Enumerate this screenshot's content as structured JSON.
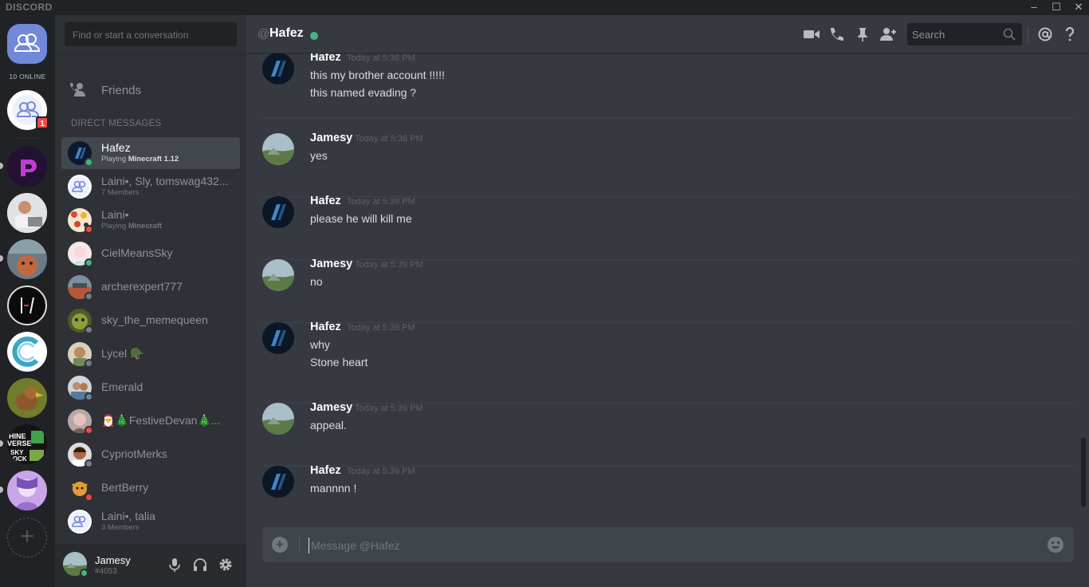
{
  "app": {
    "brand": "DISCORD"
  },
  "window_controls": {
    "minimize": "–",
    "maximize": "☐",
    "close": "✕"
  },
  "guild_bar": {
    "online_label": "10 ONLINE",
    "dm_badge": "1",
    "add_server": "+"
  },
  "dm_sidebar": {
    "search_placeholder": "Find or start a conversation",
    "friends_label": "Friends",
    "direct_messages_heading": "DIRECT MESSAGES",
    "items": [
      {
        "name": "Hafez",
        "sub_prefix": "Playing ",
        "sub_bold": "Minecraft 1.12",
        "status": "online",
        "active": true
      },
      {
        "name": "Laini•, Sly, tomswag432...",
        "sub_prefix": "7 Members",
        "sub_bold": "",
        "status": "",
        "active": false
      },
      {
        "name": "Laini•",
        "sub_prefix": "Playing ",
        "sub_bold": "Minecraft",
        "status": "dnd",
        "active": false
      },
      {
        "name": "CielMeansSky",
        "sub_prefix": "",
        "sub_bold": "",
        "status": "online",
        "active": false
      },
      {
        "name": "archerexpert777",
        "sub_prefix": "",
        "sub_bold": "",
        "status": "offline",
        "active": false
      },
      {
        "name": "sky_the_memequeen",
        "sub_prefix": "",
        "sub_bold": "",
        "status": "offline",
        "active": false
      },
      {
        "name": "Lycel 🪖",
        "sub_prefix": "",
        "sub_bold": "",
        "status": "offline",
        "active": false
      },
      {
        "name": "Emerald",
        "sub_prefix": "",
        "sub_bold": "",
        "status": "offline",
        "active": false
      },
      {
        "name": "🎅🎄FestiveDevan🎄...",
        "sub_prefix": "",
        "sub_bold": "",
        "status": "dnd",
        "active": false
      },
      {
        "name": "CypriotMerks",
        "sub_prefix": "",
        "sub_bold": "",
        "status": "offline",
        "active": false
      },
      {
        "name": "BertBerry",
        "sub_prefix": "",
        "sub_bold": "",
        "status": "dnd",
        "active": false
      },
      {
        "name": "Laini•, talia",
        "sub_prefix": "3 Members",
        "sub_bold": "",
        "status": "",
        "active": false
      }
    ]
  },
  "user_panel": {
    "username": "Jamesy",
    "tag": "#4053"
  },
  "chat": {
    "at_symbol": "@",
    "recipient": "Hafez",
    "search_placeholder": "Search",
    "composer_placeholder": "Message @Hafez",
    "messages": [
      {
        "author": "Hafez",
        "time": "Today at 5:38 PM",
        "lines": [
          "this my brother account !!!!!",
          "this named evading ?"
        ]
      },
      {
        "author": "Jamesy",
        "time": "Today at 5:38 PM",
        "lines": [
          "yes"
        ]
      },
      {
        "author": "Hafez",
        "time": "Today at 5:39 PM",
        "lines": [
          "please he will kill me"
        ]
      },
      {
        "author": "Jamesy",
        "time": "Today at 5:39 PM",
        "lines": [
          "no"
        ]
      },
      {
        "author": "Hafez",
        "time": "Today at 5:39 PM",
        "lines": [
          "why",
          "Stone heart"
        ]
      },
      {
        "author": "Jamesy",
        "time": "Today at 5:39 PM",
        "lines": [
          "appeal."
        ]
      },
      {
        "author": "Hafez",
        "time": "Today at 5:39 PM",
        "lines": [
          "mannnn !"
        ]
      }
    ]
  },
  "colors": {
    "online": "#43b581",
    "dnd": "#f04747",
    "offline": "#747f8d",
    "accent": "#7289da"
  }
}
